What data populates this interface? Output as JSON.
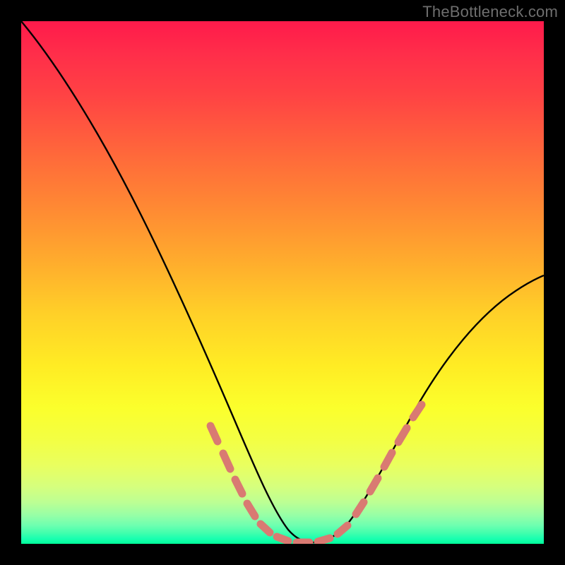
{
  "watermark": "TheBottleneck.com",
  "chart_data": {
    "type": "line",
    "title": "",
    "xlabel": "",
    "ylabel": "",
    "xlim": [
      0,
      100
    ],
    "ylim": [
      0,
      100
    ],
    "grid": false,
    "legend": false,
    "background": "rainbow-vertical",
    "series": [
      {
        "name": "bottleneck-curve",
        "stroke": "#000000",
        "x": [
          0,
          5,
          10,
          15,
          20,
          25,
          30,
          35,
          40,
          45,
          48,
          50,
          52,
          55,
          58,
          60,
          63,
          66,
          70,
          75,
          80,
          85,
          90,
          95,
          100
        ],
        "y": [
          100,
          93,
          85,
          76,
          66,
          55,
          44,
          34,
          24,
          14,
          8,
          4,
          2,
          1,
          1,
          2,
          4,
          8,
          14,
          22,
          30,
          37,
          43,
          47,
          50
        ]
      },
      {
        "name": "highlight-dashes-left",
        "stroke": "#d97a72",
        "style": "dashed",
        "x": [
          35,
          36.5,
          39,
          40.5,
          42.5,
          44,
          46,
          47.5
        ],
        "y": [
          22,
          19,
          14,
          11,
          8,
          6,
          3.5,
          2.2
        ]
      },
      {
        "name": "highlight-dashes-bottom",
        "stroke": "#d97a72",
        "style": "dashed",
        "x": [
          48,
          49.5,
          51.5,
          53,
          55,
          57,
          59,
          60.5
        ],
        "y": [
          1.5,
          1.2,
          1.0,
          1.0,
          1.0,
          1.3,
          1.8,
          2.2
        ]
      },
      {
        "name": "highlight-dashes-right",
        "stroke": "#d97a72",
        "style": "dashed",
        "x": [
          64,
          65.5,
          68,
          69.5,
          71.5,
          73,
          75,
          76.5
        ],
        "y": [
          6,
          8,
          12,
          15,
          18,
          20,
          23,
          25
        ]
      }
    ]
  }
}
